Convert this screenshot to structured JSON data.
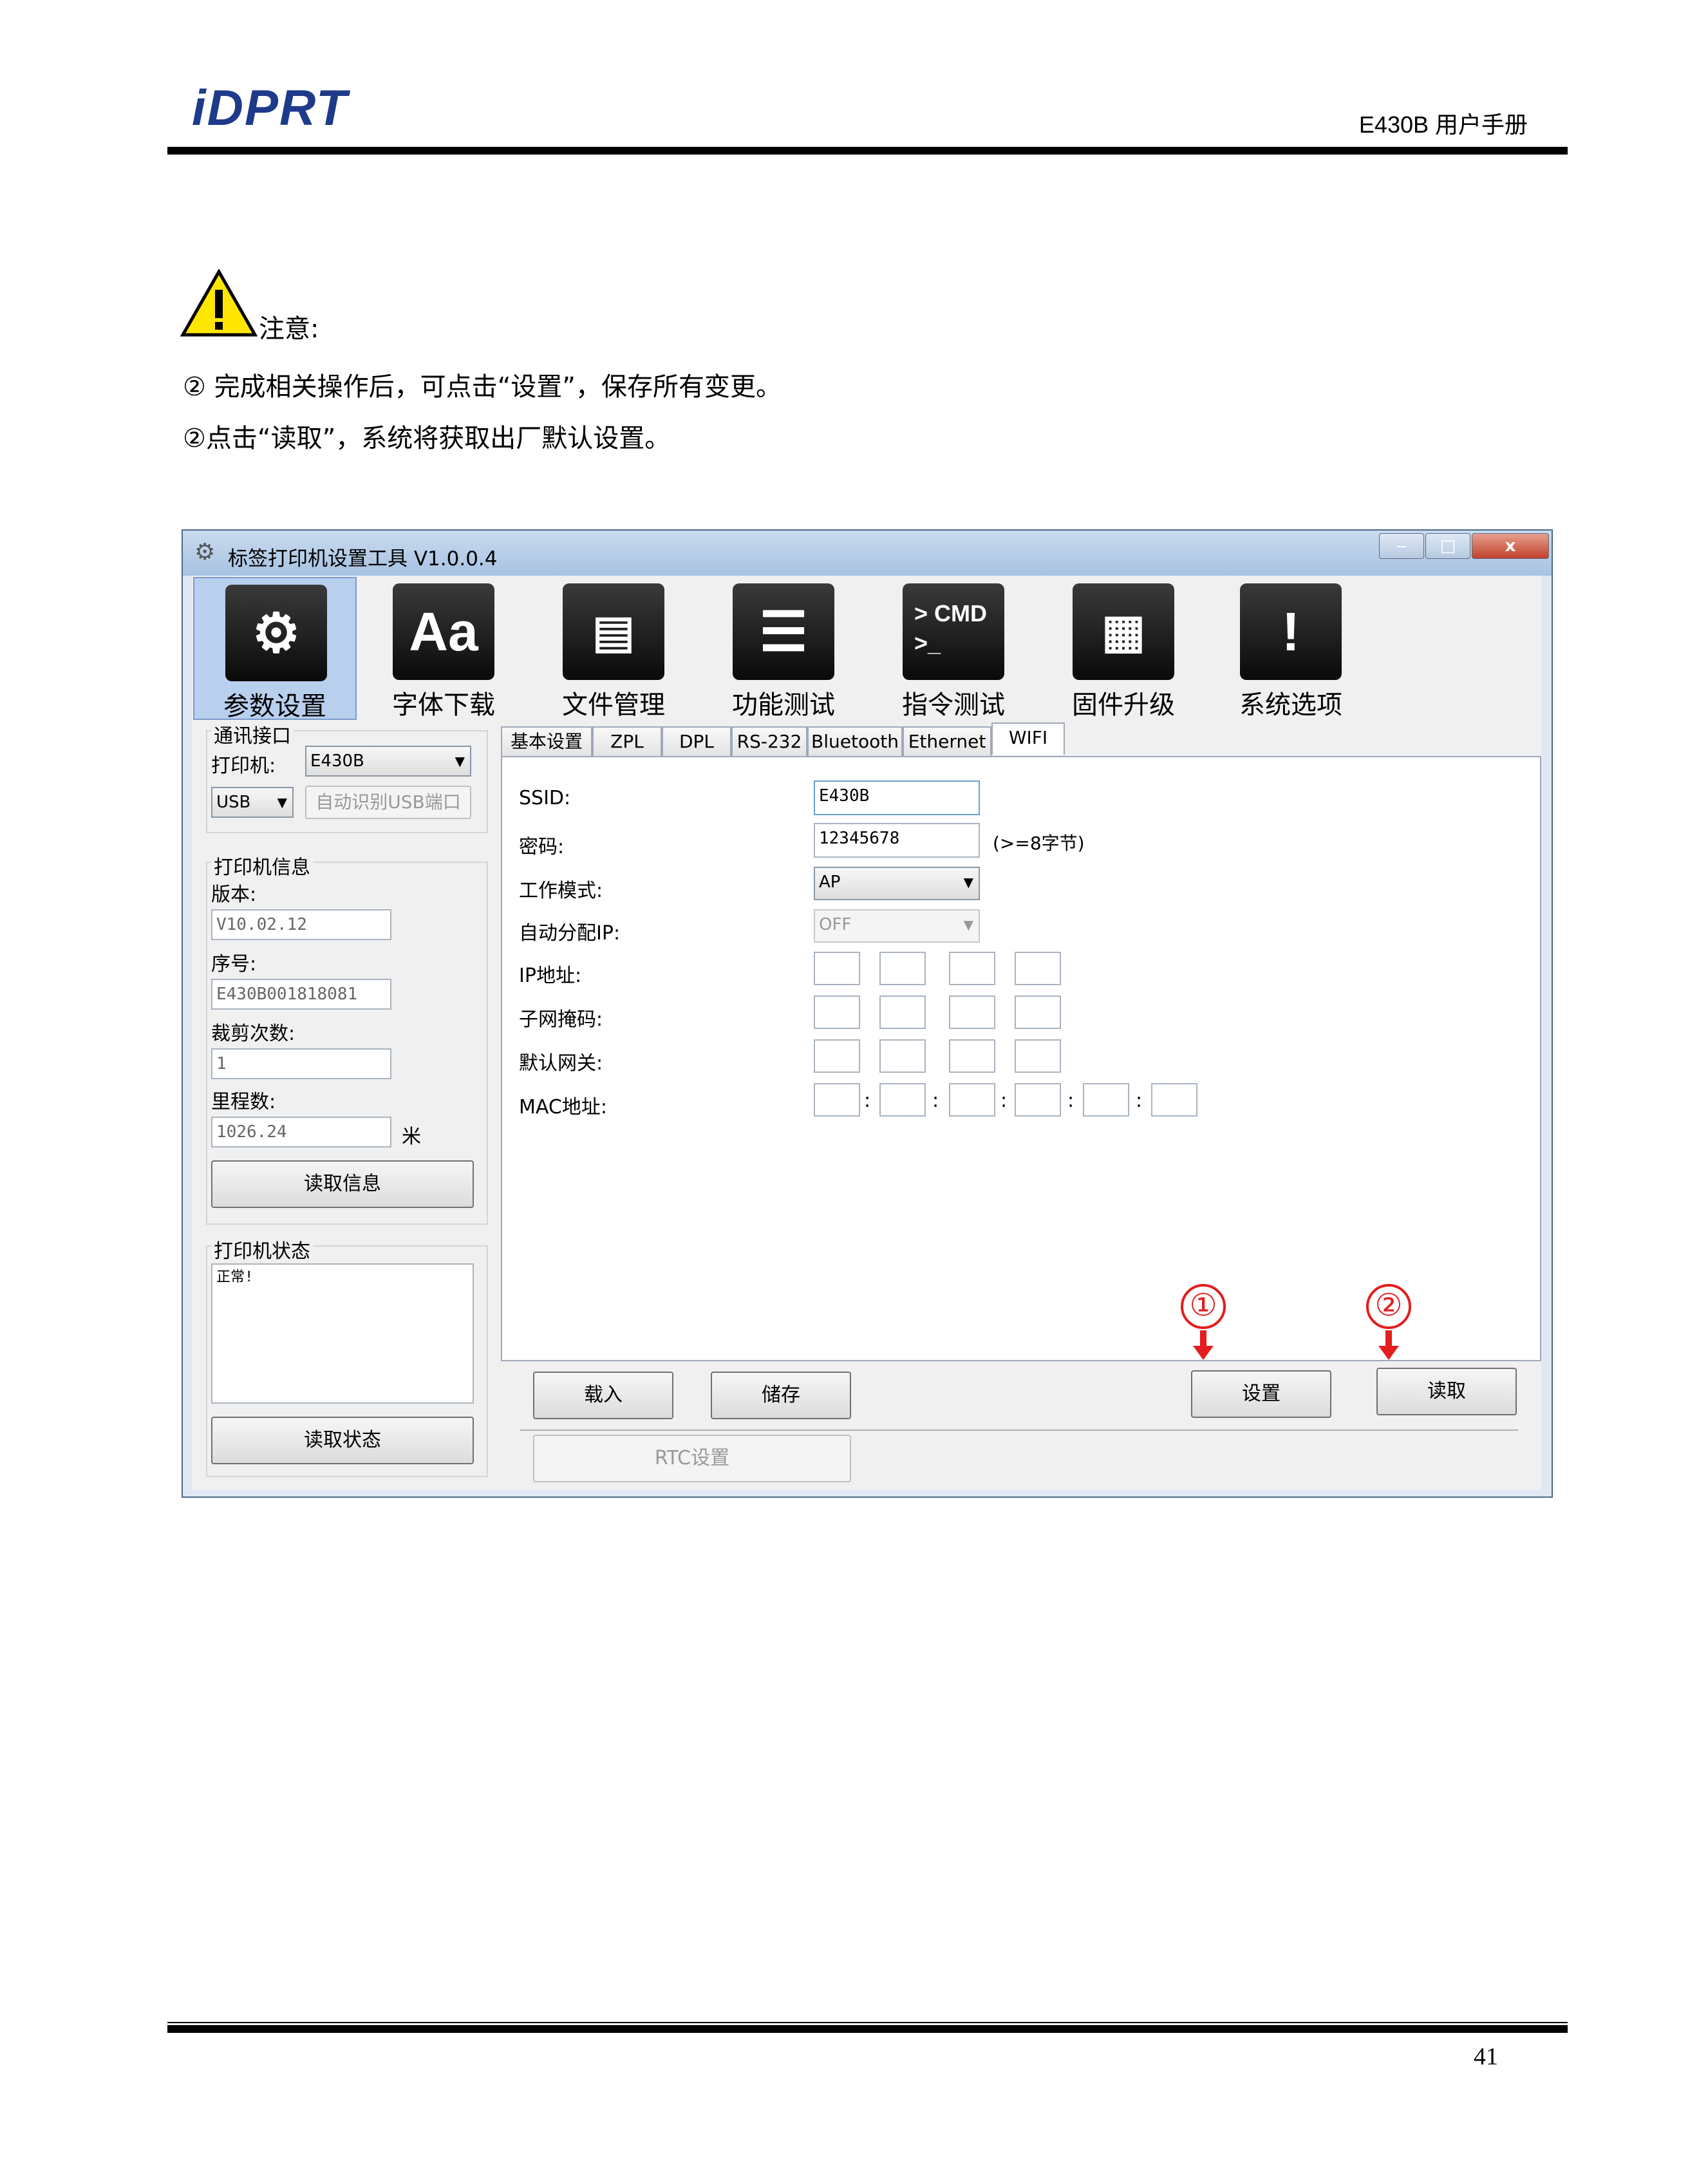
{
  "header": {
    "logo": "iDPRT",
    "doc_title": "E430B 用户手册"
  },
  "notice": {
    "label": "注意:",
    "lines": [
      "② 完成相关操作后，可点击“设置”，保存所有变更。",
      "②点击“读取”，系统将获取出厂默认设置。"
    ]
  },
  "window": {
    "title": "标签打印机设置工具 V1.0.0.4",
    "controls": {
      "minimize": "‒",
      "maximize": "□",
      "close": "x"
    },
    "toolbar": [
      {
        "label": "参数设置",
        "icon": "settings-gear-icon",
        "glyph": "⚙",
        "active": true
      },
      {
        "label": "字体下载",
        "icon": "font-aa-icon",
        "glyph": "Aa"
      },
      {
        "label": "文件管理",
        "icon": "notebook-icon",
        "glyph": "📓"
      },
      {
        "label": "功能测试",
        "icon": "list-icon",
        "glyph": "☰"
      },
      {
        "label": "指令测试",
        "icon": "cmd-terminal-icon",
        "glyph": "> CMD\n>_"
      },
      {
        "label": "固件升级",
        "icon": "chip-icon",
        "glyph": "▦"
      },
      {
        "label": "系统选项",
        "icon": "alert-bubble-icon",
        "glyph": "!"
      }
    ],
    "left": {
      "comm": {
        "title": "通讯接口",
        "printer_label": "打印机:",
        "printer_value": "E430B",
        "port_value": "USB",
        "auto_usb_button": "自动识别USB端口"
      },
      "info": {
        "title": "打印机信息",
        "version_label": "版本:",
        "version_value": "V10.02.12",
        "serial_label": "序号:",
        "serial_value": "E430B001818081",
        "cut_label": "裁剪次数:",
        "cut_value": "1",
        "mileage_label": "里程数:",
        "mileage_value": "1026.24",
        "mileage_unit": "米",
        "read_info_button": "读取信息"
      },
      "status": {
        "title": "打印机状态",
        "value": "正常!",
        "read_status_button": "读取状态"
      }
    },
    "tabs": [
      "基本设置",
      "ZPL",
      "DPL",
      "RS-232",
      "Bluetooth",
      "Ethernet",
      "WIFI"
    ],
    "selected_tab": "WIFI",
    "wifi": {
      "ssid_label": "SSID:",
      "ssid_value": "E430B",
      "pwd_label": "密码:",
      "pwd_value": "12345678",
      "pwd_hint": "(>=8字节)",
      "mode_label": "工作模式:",
      "mode_value": "AP",
      "dhcp_label": "自动分配IP:",
      "dhcp_value": "OFF",
      "ip_label": "IP地址:",
      "mask_label": "子网掩码:",
      "gateway_label": "默认网关:",
      "mac_label": "MAC地址:"
    },
    "bottom": {
      "load_button": "载入",
      "save_button": "储存",
      "set_button": "设置",
      "read_button": "读取",
      "rtc_button": "RTC设置"
    },
    "callouts": [
      "①",
      "②"
    ]
  },
  "footer": {
    "page_number": "41"
  },
  "colors": {
    "callout": "#e31e1e",
    "logo_blue": "#1e3a8a",
    "logo_red": "#c21f2a"
  }
}
